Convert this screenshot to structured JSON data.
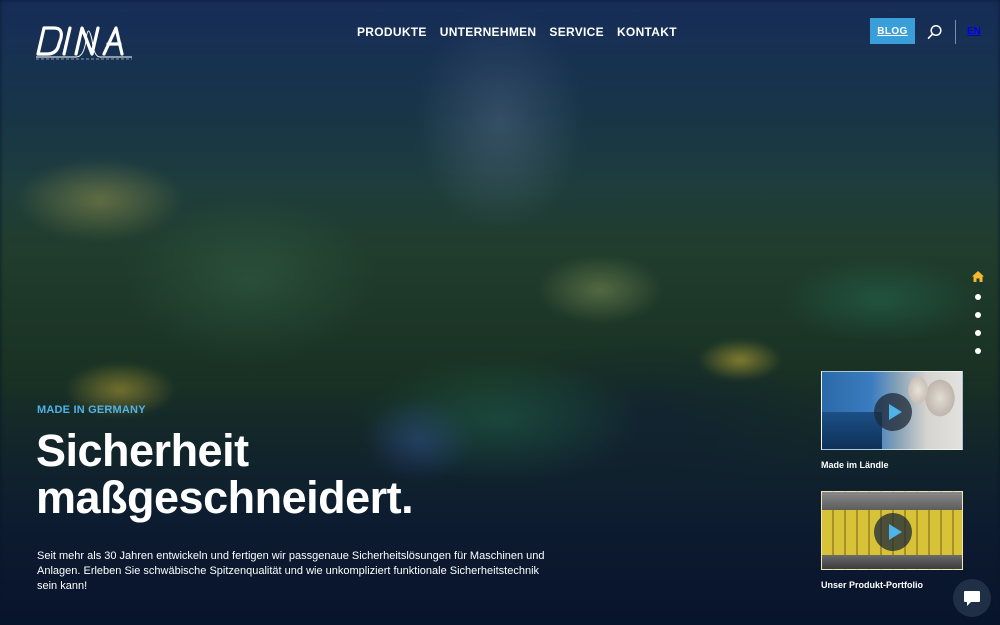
{
  "header": {
    "logo_text": "DINA",
    "nav": [
      {
        "label": "PRODUKTE"
      },
      {
        "label": "UNTERNEHMEN"
      },
      {
        "label": "SERVICE"
      },
      {
        "label": "KONTAKT"
      }
    ],
    "blog_label": "BLOG",
    "lang_label": "EN",
    "search_icon": "search-icon"
  },
  "hero": {
    "eyebrow": "MADE IN GERMANY",
    "title_line1": "Sicherheit",
    "title_line2": "maßgeschneidert.",
    "text": "Seit mehr als 30 Jahren entwickeln und fertigen wir passgenaue Sicherheitslösungen für Maschinen und Anlagen. Erleben Sie schwäbische Spitzenqualität und wie unkompliziert funktionale Sicherheitstechnik sein kann!"
  },
  "videos": [
    {
      "caption": "Made im Ländle"
    },
    {
      "caption": "Unser Produkt-Portfolio"
    }
  ],
  "side_nav": {
    "icons": [
      "home-icon",
      "dot",
      "dot",
      "dot",
      "dot"
    ]
  },
  "colors": {
    "accent": "#3a9fd8",
    "eyebrow": "#4eb3e8"
  }
}
